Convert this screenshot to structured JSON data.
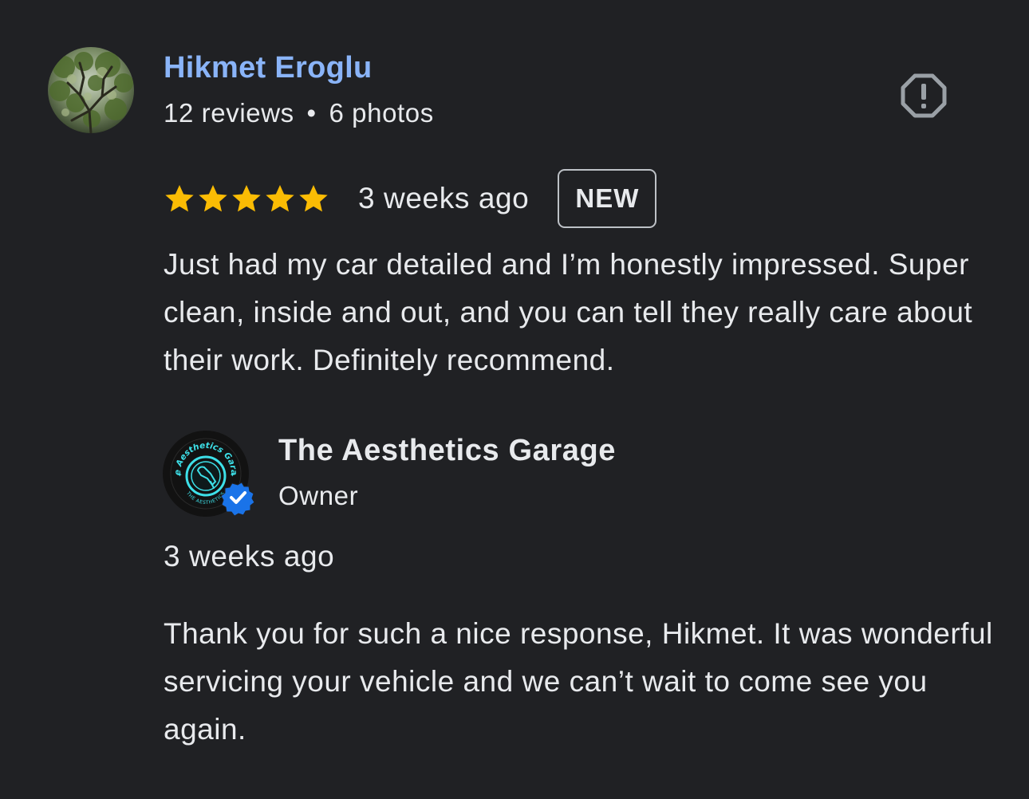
{
  "review": {
    "reviewer_name": "Hikmet Eroglu",
    "reviews_count": "12 reviews",
    "separator": "•",
    "photos_count": "6 photos",
    "rating": 5,
    "rating_max": 5,
    "time": "3 weeks ago",
    "badge": "NEW",
    "text": "Just had my car detailed and I’m honestly impressed. Super clean, inside and out, and you can tell they really care about their work. Definitely recommend."
  },
  "owner_reply": {
    "business_name": "The Aesthetics Garage",
    "role": "Owner",
    "logo_text_top": "The Aesthetics Garage",
    "logo_text_bottom": "THE AESTHETICS",
    "time": "3 weeks ago",
    "text": "Thank you for such a nice response, Hikmet. It was wonderful servicing your vehicle and we can’t wait to come see you again."
  },
  "icons": {
    "report": "report-flag-icon",
    "star": "star-icon",
    "verified": "verified-check-icon"
  },
  "colors": {
    "background": "#202124",
    "reviewer_name": "#8ab4f8",
    "star": "#fbbc04",
    "text": "#e8eaed",
    "verified": "#1a73e8",
    "logo_accent": "#3de0e8"
  }
}
